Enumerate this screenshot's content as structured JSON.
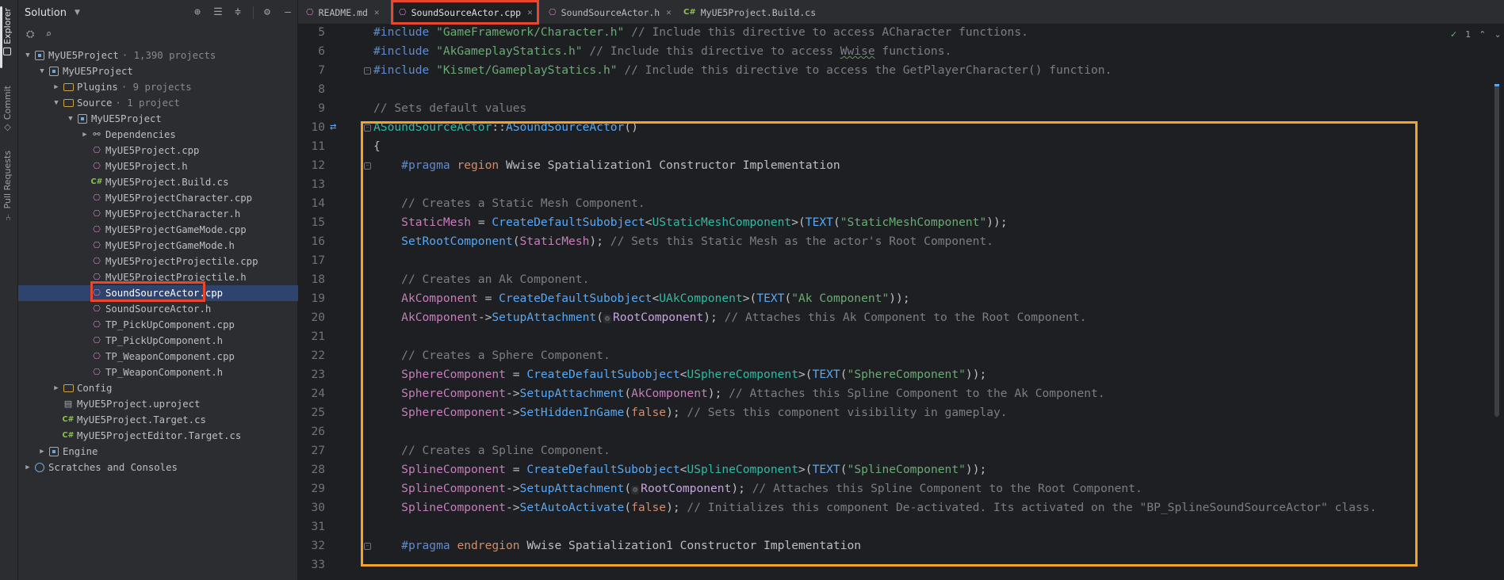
{
  "activity_bar": {
    "explorer": "Explorer",
    "commit": "Commit",
    "pull_requests": "Pull Requests"
  },
  "sidebar": {
    "title": "Solution",
    "tree": [
      {
        "label": "MyUE5Project",
        "meta": "· 1,390 projects",
        "icon": "project-icon",
        "indent": 0,
        "arrow": "down"
      },
      {
        "label": "MyUE5Project",
        "meta": "",
        "icon": "project-icon",
        "indent": 1,
        "arrow": "down"
      },
      {
        "label": "Plugins",
        "meta": "· 9 projects",
        "icon": "folder-icon",
        "indent": 2,
        "arrow": "right"
      },
      {
        "label": "Source",
        "meta": "· 1 project",
        "icon": "folder-icon",
        "indent": 2,
        "arrow": "down"
      },
      {
        "label": "MyUE5Project",
        "meta": "",
        "icon": "cpp-project-icon",
        "indent": 3,
        "arrow": "down"
      },
      {
        "label": "Dependencies",
        "meta": "",
        "icon": "dependencies-icon",
        "indent": 4,
        "arrow": "right"
      },
      {
        "label": "MyUE5Project.cpp",
        "meta": "",
        "icon": "cpp-file-icon",
        "indent": 4,
        "arrow": ""
      },
      {
        "label": "MyUE5Project.h",
        "meta": "",
        "icon": "h-file-icon",
        "indent": 4,
        "arrow": ""
      },
      {
        "label": "MyUE5Project.Build.cs",
        "meta": "",
        "icon": "cs-file-icon",
        "indent": 4,
        "arrow": ""
      },
      {
        "label": "MyUE5ProjectCharacter.cpp",
        "meta": "",
        "icon": "cpp-file-icon",
        "indent": 4,
        "arrow": ""
      },
      {
        "label": "MyUE5ProjectCharacter.h",
        "meta": "",
        "icon": "h-file-icon",
        "indent": 4,
        "arrow": ""
      },
      {
        "label": "MyUE5ProjectGameMode.cpp",
        "meta": "",
        "icon": "cpp-file-icon",
        "indent": 4,
        "arrow": ""
      },
      {
        "label": "MyUE5ProjectGameMode.h",
        "meta": "",
        "icon": "h-file-icon",
        "indent": 4,
        "arrow": ""
      },
      {
        "label": "MyUE5ProjectProjectile.cpp",
        "meta": "",
        "icon": "cpp-file-icon",
        "indent": 4,
        "arrow": ""
      },
      {
        "label": "MyUE5ProjectProjectile.h",
        "meta": "",
        "icon": "h-file-icon",
        "indent": 4,
        "arrow": ""
      },
      {
        "label": "SoundSourceActor.cpp",
        "meta": "",
        "icon": "cpp-file-icon",
        "indent": 4,
        "arrow": "",
        "selected": true
      },
      {
        "label": "SoundSourceActor.h",
        "meta": "",
        "icon": "h-file-icon",
        "indent": 4,
        "arrow": ""
      },
      {
        "label": "TP_PickUpComponent.cpp",
        "meta": "",
        "icon": "cpp-file-icon",
        "indent": 4,
        "arrow": ""
      },
      {
        "label": "TP_PickUpComponent.h",
        "meta": "",
        "icon": "h-file-icon",
        "indent": 4,
        "arrow": ""
      },
      {
        "label": "TP_WeaponComponent.cpp",
        "meta": "",
        "icon": "cpp-file-icon",
        "indent": 4,
        "arrow": ""
      },
      {
        "label": "TP_WeaponComponent.h",
        "meta": "",
        "icon": "h-file-icon",
        "indent": 4,
        "arrow": ""
      },
      {
        "label": "Config",
        "meta": "",
        "icon": "folder-icon",
        "indent": 2,
        "arrow": "right"
      },
      {
        "label": "MyUE5Project.uproject",
        "meta": "",
        "icon": "uproject-icon",
        "indent": 2,
        "arrow": ""
      },
      {
        "label": "MyUE5Project.Target.cs",
        "meta": "",
        "icon": "cs-file-icon",
        "indent": 2,
        "arrow": ""
      },
      {
        "label": "MyUE5ProjectEditor.Target.cs",
        "meta": "",
        "icon": "cs-file-icon",
        "indent": 2,
        "arrow": ""
      },
      {
        "label": "Engine",
        "meta": "",
        "icon": "project-icon",
        "indent": 1,
        "arrow": "right"
      },
      {
        "label": "Scratches and Consoles",
        "meta": "",
        "icon": "scratches-icon",
        "indent": 0,
        "arrow": "right"
      }
    ]
  },
  "tabs": [
    {
      "label": "README.md",
      "icon": "markdown-icon",
      "active": false
    },
    {
      "label": "SoundSourceActor.cpp",
      "icon": "cpp-file-icon",
      "active": true
    },
    {
      "label": "SoundSourceActor.h",
      "icon": "h-file-icon",
      "active": false
    },
    {
      "label": "MyUE5Project.Build.cs",
      "icon": "cs-file-icon",
      "active": false
    }
  ],
  "inspection": {
    "count": "1"
  },
  "editor": {
    "first_line": 5,
    "lines": [
      [
        [
          "pp",
          "#include "
        ],
        [
          "str",
          "\"GameFramework/Character.h\""
        ],
        [
          "cm",
          " // Include this directive to access ACharacter functions."
        ]
      ],
      [
        [
          "pp",
          "#include "
        ],
        [
          "str",
          "\"AkGameplayStatics.h\""
        ],
        [
          "cm",
          " // Include this directive to access "
        ],
        [
          "cmu",
          "Wwise"
        ],
        [
          "cm",
          " functions."
        ]
      ],
      [
        [
          "pp",
          "#include "
        ],
        [
          "str",
          "\"Kismet/GameplayStatics.h\""
        ],
        [
          "cm",
          " // Include this directive to access the GetPlayerCharacter() function."
        ]
      ],
      [],
      [
        [
          "cm",
          "// Sets default values"
        ]
      ],
      [
        [
          "ty",
          "ASoundSourceActor"
        ],
        [
          "dim",
          "::"
        ],
        [
          "fn",
          "ASoundSourceActor"
        ],
        [
          "dim",
          "()"
        ]
      ],
      [
        [
          "dim",
          "{"
        ]
      ],
      [
        [
          "dim",
          "    "
        ],
        [
          "pp",
          "#pragma "
        ],
        [
          "kw",
          "region "
        ],
        [
          "dim",
          "Wwise Spatialization1 Constructor Implementation"
        ]
      ],
      [],
      [
        [
          "dim",
          "    "
        ],
        [
          "cm",
          "// Creates a Static Mesh Component."
        ]
      ],
      [
        [
          "dim",
          "    "
        ],
        [
          "var",
          "StaticMesh"
        ],
        [
          "dim",
          " = "
        ],
        [
          "fn",
          "CreateDefaultSubobject"
        ],
        [
          "dim",
          "<"
        ],
        [
          "ty",
          "UStaticMeshComponent"
        ],
        [
          "dim",
          ">("
        ],
        [
          "fn",
          "TEXT"
        ],
        [
          "dim",
          "("
        ],
        [
          "str",
          "\"StaticMeshComponent\""
        ],
        [
          "dim",
          "));"
        ]
      ],
      [
        [
          "dim",
          "    "
        ],
        [
          "fn",
          "SetRootComponent"
        ],
        [
          "dim",
          "("
        ],
        [
          "var",
          "StaticMesh"
        ],
        [
          "dim",
          ");"
        ],
        [
          "cm",
          " // Sets this Static Mesh as the actor's Root Component."
        ]
      ],
      [],
      [
        [
          "dim",
          "    "
        ],
        [
          "cm",
          "// Creates an Ak Component."
        ]
      ],
      [
        [
          "dim",
          "    "
        ],
        [
          "var",
          "AkComponent"
        ],
        [
          "dim",
          " = "
        ],
        [
          "fn",
          "CreateDefaultSubobject"
        ],
        [
          "dim",
          "<"
        ],
        [
          "ty",
          "UAkComponent"
        ],
        [
          "dim",
          ">("
        ],
        [
          "fn",
          "TEXT"
        ],
        [
          "dim",
          "("
        ],
        [
          "str",
          "\"Ak Component\""
        ],
        [
          "dim",
          "));"
        ]
      ],
      [
        [
          "dim",
          "    "
        ],
        [
          "var",
          "AkComponent"
        ],
        [
          "dim",
          "->"
        ],
        [
          "fn",
          "SetupAttachment"
        ],
        [
          "dim",
          "("
        ],
        [
          "hint",
          "⚙"
        ],
        [
          "mem",
          "RootComponent"
        ],
        [
          "dim",
          ");"
        ],
        [
          "cm",
          " // Attaches this Ak Component to the Root Component."
        ]
      ],
      [],
      [
        [
          "dim",
          "    "
        ],
        [
          "cm",
          "// Creates a Sphere Component."
        ]
      ],
      [
        [
          "dim",
          "    "
        ],
        [
          "var",
          "SphereComponent"
        ],
        [
          "dim",
          " = "
        ],
        [
          "fn",
          "CreateDefaultSubobject"
        ],
        [
          "dim",
          "<"
        ],
        [
          "ty",
          "USphereComponent"
        ],
        [
          "dim",
          ">("
        ],
        [
          "fn",
          "TEXT"
        ],
        [
          "dim",
          "("
        ],
        [
          "str",
          "\"SphereComponent\""
        ],
        [
          "dim",
          "));"
        ]
      ],
      [
        [
          "dim",
          "    "
        ],
        [
          "var",
          "SphereComponent"
        ],
        [
          "dim",
          "->"
        ],
        [
          "fn",
          "SetupAttachment"
        ],
        [
          "dim",
          "("
        ],
        [
          "var",
          "AkComponent"
        ],
        [
          "dim",
          ");"
        ],
        [
          "cm",
          " // Attaches this Spline Component to the Ak Component."
        ]
      ],
      [
        [
          "dim",
          "    "
        ],
        [
          "var",
          "SphereComponent"
        ],
        [
          "dim",
          "->"
        ],
        [
          "fn",
          "SetHiddenInGame"
        ],
        [
          "dim",
          "("
        ],
        [
          "kw",
          "false"
        ],
        [
          "dim",
          ");"
        ],
        [
          "cm",
          " // Sets this component visibility in gameplay."
        ]
      ],
      [],
      [
        [
          "dim",
          "    "
        ],
        [
          "cm",
          "// Creates a Spline Component."
        ]
      ],
      [
        [
          "dim",
          "    "
        ],
        [
          "var",
          "SplineComponent"
        ],
        [
          "dim",
          " = "
        ],
        [
          "fn",
          "CreateDefaultSubobject"
        ],
        [
          "dim",
          "<"
        ],
        [
          "ty",
          "USplineComponent"
        ],
        [
          "dim",
          ">("
        ],
        [
          "fn",
          "TEXT"
        ],
        [
          "dim",
          "("
        ],
        [
          "str",
          "\"SplineComponent\""
        ],
        [
          "dim",
          "));"
        ]
      ],
      [
        [
          "dim",
          "    "
        ],
        [
          "var",
          "SplineComponent"
        ],
        [
          "dim",
          "->"
        ],
        [
          "fn",
          "SetupAttachment"
        ],
        [
          "dim",
          "("
        ],
        [
          "hint",
          "⚙"
        ],
        [
          "mem",
          "RootComponent"
        ],
        [
          "dim",
          ");"
        ],
        [
          "cm",
          " // Attaches this Spline Component to the Root Component."
        ]
      ],
      [
        [
          "dim",
          "    "
        ],
        [
          "var",
          "SplineComponent"
        ],
        [
          "dim",
          "->"
        ],
        [
          "fn",
          "SetAutoActivate"
        ],
        [
          "dim",
          "("
        ],
        [
          "kw",
          "false"
        ],
        [
          "dim",
          ");"
        ],
        [
          "cm",
          " // Initializes this component De-activated. Its activated on the \"BP_SplineSoundSourceActor\" class."
        ]
      ],
      [],
      [
        [
          "dim",
          "    "
        ],
        [
          "pp",
          "#pragma "
        ],
        [
          "kw",
          "endregion "
        ],
        [
          "dim",
          "Wwise Spatialization1 Constructor Implementation"
        ]
      ],
      []
    ]
  }
}
